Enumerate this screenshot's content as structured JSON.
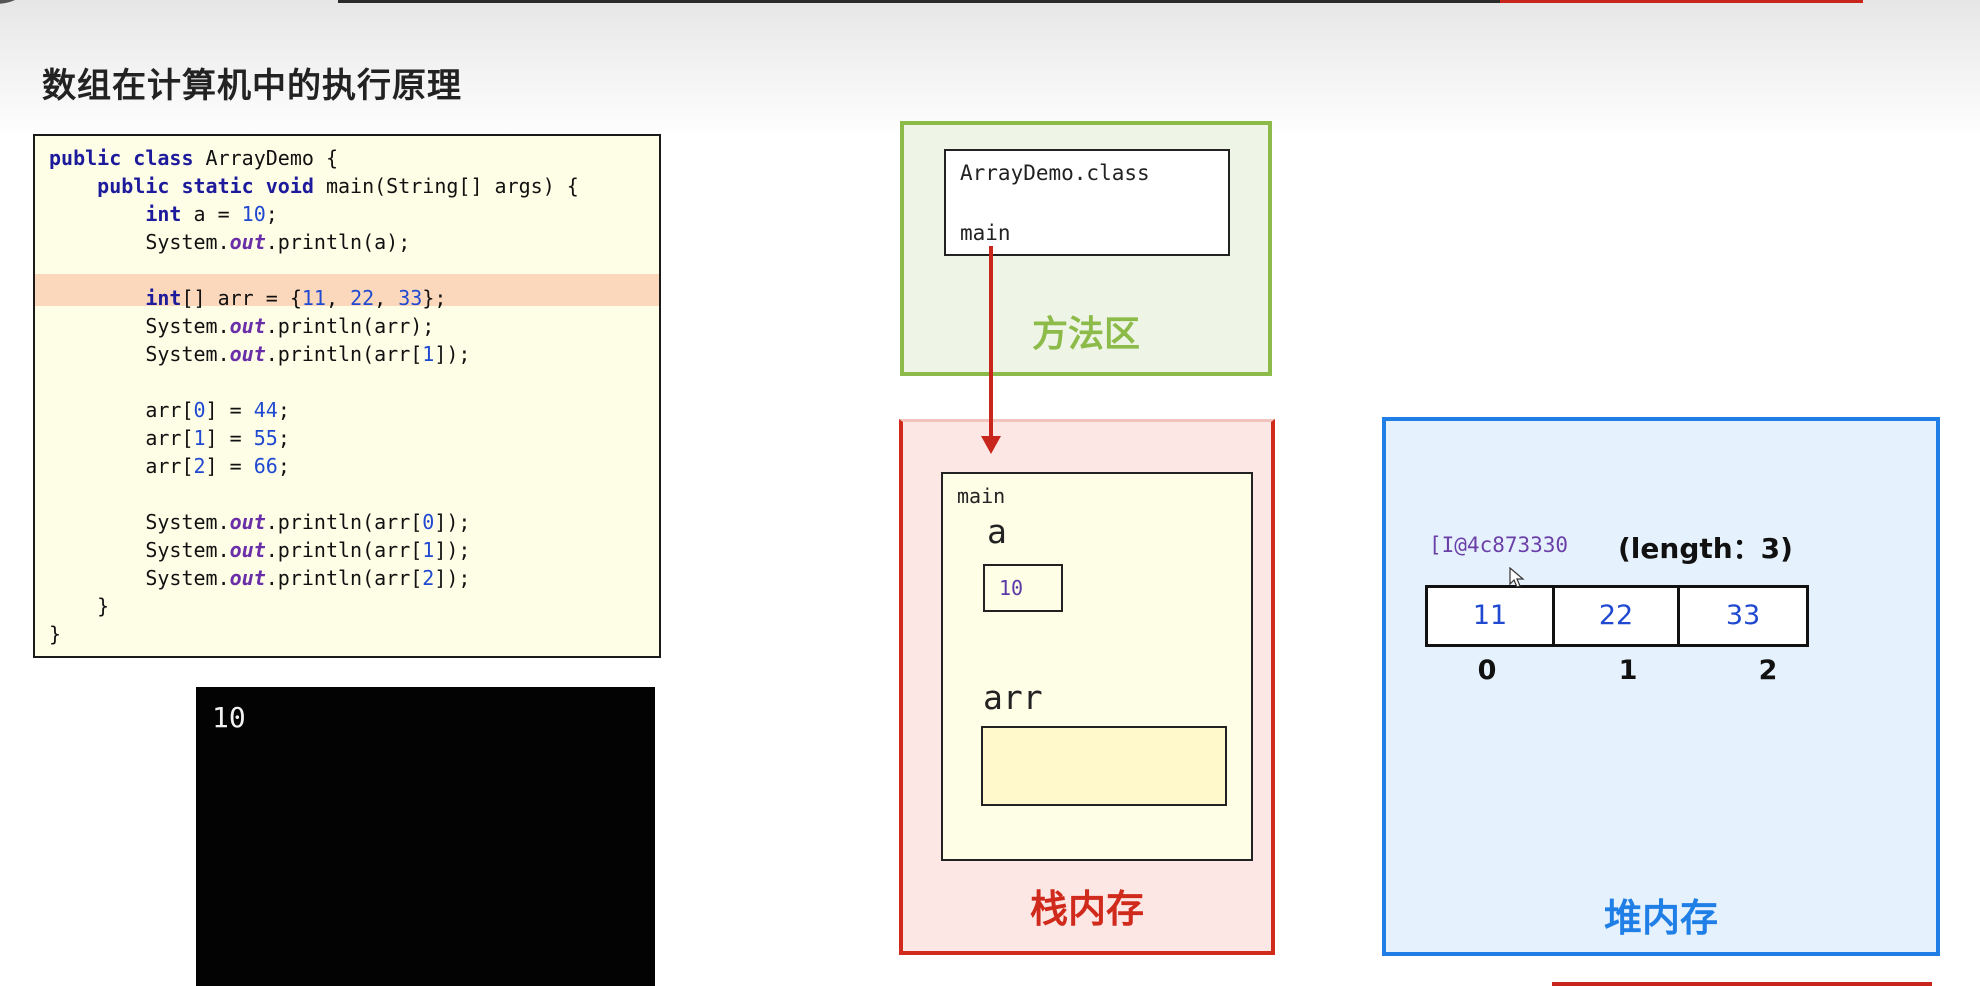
{
  "page": {
    "title": "数组在计算机中的执行原理"
  },
  "code": {
    "lines": [
      "public class ArrayDemo {",
      "    public static void main(String[] args) {",
      "        int a = 10;",
      "        System.out.println(a);",
      "",
      "        int[] arr = {11, 22, 33};",
      "        System.out.println(arr);",
      "        System.out.println(arr[1]);",
      "",
      "        arr[0] = 44;",
      "        arr[1] = 55;",
      "        arr[2] = 66;",
      "",
      "        System.out.println(arr[0]);",
      "        System.out.println(arr[1]);",
      "        System.out.println(arr[2]);",
      "    }",
      "}"
    ],
    "highlighted_line": 6
  },
  "console": {
    "output": "10"
  },
  "method_area": {
    "label": "方法区",
    "class_name": "ArrayDemo.class",
    "method": "main"
  },
  "stack": {
    "label": "栈内存",
    "frame_name": "main",
    "var_a": {
      "name": "a",
      "value": "10"
    },
    "var_arr": {
      "name": "arr",
      "value": ""
    }
  },
  "heap": {
    "label": "堆内存",
    "address": "[I@4c873330",
    "length_label": "(length：3)",
    "values": [
      "11",
      "22",
      "33"
    ],
    "indices": [
      "0",
      "1",
      "2"
    ]
  },
  "colors": {
    "method_area": "#8dbb4a",
    "stack_area": "#d02a1c",
    "heap_area": "#1f7fe6",
    "highlight": "#fbd8bb"
  }
}
